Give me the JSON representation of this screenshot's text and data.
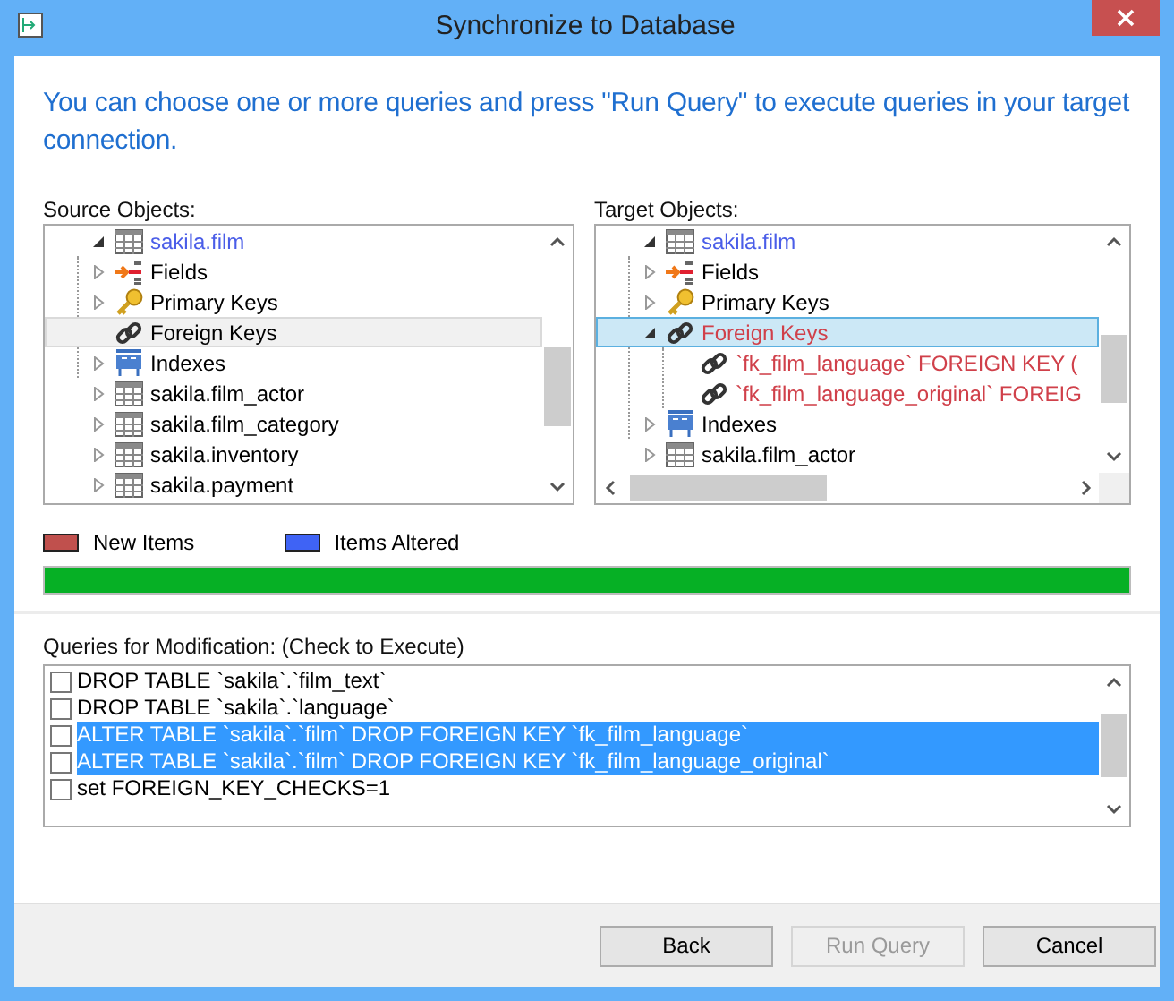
{
  "window": {
    "title": "Synchronize to Database"
  },
  "intro": "You can choose one or more queries and press \"Run Query\" to execute queries in your target connection.",
  "source_tree": {
    "label": "Source Objects:",
    "items": [
      {
        "label": "sakila.film",
        "kind": "table",
        "color": "#4a5de8",
        "expanded": true,
        "selected": false,
        "children": [
          {
            "label": "Fields",
            "kind": "fields",
            "expanded": false,
            "selected": false
          },
          {
            "label": "Primary Keys",
            "kind": "key",
            "expanded": false,
            "selected": false
          },
          {
            "label": "Foreign Keys",
            "kind": "link",
            "selected": true
          },
          {
            "label": "Indexes",
            "kind": "index",
            "expanded": false,
            "selected": false
          }
        ]
      },
      {
        "label": "sakila.film_actor",
        "kind": "table",
        "expanded": false,
        "selected": false
      },
      {
        "label": "sakila.film_category",
        "kind": "table",
        "expanded": false,
        "selected": false
      },
      {
        "label": "sakila.inventory",
        "kind": "table",
        "expanded": false,
        "selected": false
      },
      {
        "label": "sakila.payment",
        "kind": "table",
        "expanded": false,
        "selected": false
      }
    ]
  },
  "target_tree": {
    "label": "Target Objects:",
    "items": [
      {
        "label": "sakila.film",
        "kind": "table",
        "color": "#4a5de8",
        "expanded": true,
        "selected": false,
        "children": [
          {
            "label": "Fields",
            "kind": "fields",
            "expanded": false,
            "selected": false
          },
          {
            "label": "Primary Keys",
            "kind": "key",
            "expanded": false,
            "selected": false
          },
          {
            "label": "Foreign Keys",
            "kind": "link",
            "color": "#d0404a",
            "expanded": true,
            "selected": true,
            "children": [
              {
                "label": "`fk_film_language` FOREIGN KEY (",
                "kind": "link",
                "color": "#d0404a",
                "selected": false
              },
              {
                "label": "`fk_film_language_original` FOREIG",
                "kind": "link",
                "color": "#d0404a",
                "selected": false
              }
            ]
          },
          {
            "label": "Indexes",
            "kind": "index",
            "expanded": false,
            "selected": false
          }
        ]
      },
      {
        "label": "sakila.film_actor",
        "kind": "table",
        "expanded": false,
        "selected": false
      }
    ]
  },
  "legend": [
    {
      "label": "New Items",
      "color": "#c0504d"
    },
    {
      "label": "Items Altered",
      "color": "#3f63f5"
    }
  ],
  "progress": {
    "level": 1.0
  },
  "queries": {
    "label": "Queries for Modification: (Check to Execute)",
    "items": [
      {
        "text": "DROP TABLE `sakila`.`film_text`",
        "checked": false,
        "selected": false
      },
      {
        "text": "DROP TABLE `sakila`.`language`",
        "checked": false,
        "selected": false
      },
      {
        "text": "ALTER TABLE `sakila`.`film` DROP FOREIGN KEY `fk_film_language`",
        "checked": false,
        "selected": true
      },
      {
        "text": "ALTER TABLE `sakila`.`film` DROP FOREIGN KEY `fk_film_language_original`",
        "checked": false,
        "selected": true
      },
      {
        "text": "set FOREIGN_KEY_CHECKS=1",
        "checked": false,
        "selected": false
      }
    ]
  },
  "buttons": [
    {
      "label": "Back",
      "disabled": false
    },
    {
      "label": "Run Query",
      "disabled": true
    },
    {
      "label": "Cancel",
      "disabled": false
    }
  ]
}
